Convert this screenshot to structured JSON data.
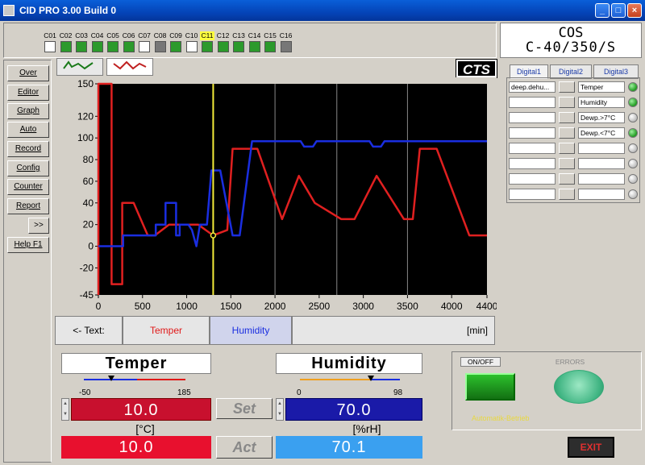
{
  "window": {
    "title": "CID PRO 3.00 Build 0",
    "min": "_",
    "max": "□",
    "close": "×"
  },
  "channels": [
    {
      "label": "C01",
      "state": "white"
    },
    {
      "label": "C02",
      "state": "green"
    },
    {
      "label": "C03",
      "state": "green"
    },
    {
      "label": "C04",
      "state": "green"
    },
    {
      "label": "C05",
      "state": "green"
    },
    {
      "label": "C06",
      "state": "green"
    },
    {
      "label": "C07",
      "state": "white"
    },
    {
      "label": "C08",
      "state": "gray"
    },
    {
      "label": "C09",
      "state": "green"
    },
    {
      "label": "C10",
      "state": "white"
    },
    {
      "label": "C11",
      "state": "green",
      "highlight": true
    },
    {
      "label": "C12",
      "state": "green"
    },
    {
      "label": "C13",
      "state": "green"
    },
    {
      "label": "C14",
      "state": "green"
    },
    {
      "label": "C15",
      "state": "green"
    },
    {
      "label": "C16",
      "state": "gray"
    }
  ],
  "cos": {
    "line1": "COS",
    "line2": "C-40/350/S"
  },
  "nav": [
    "Over",
    "Editor",
    "Graph",
    "Auto",
    "Record",
    "Config",
    "Counter",
    "Report",
    ">>",
    "Help F1"
  ],
  "logo": "CTS",
  "digital_tabs": [
    "Digital1",
    "Digital2",
    "Digital3"
  ],
  "digital_rows": [
    {
      "left": "deep.dehu...",
      "right": "Temper",
      "led": "on"
    },
    {
      "left": "",
      "right": "Humidity",
      "led": "on"
    },
    {
      "left": "",
      "right": "Dewp.>7°C",
      "led": "off"
    },
    {
      "left": "",
      "right": "Dewp.<7°C",
      "led": "on"
    },
    {
      "left": "",
      "right": "",
      "led": "off"
    },
    {
      "left": "",
      "right": "",
      "led": "off"
    },
    {
      "left": "",
      "right": "",
      "led": "off"
    },
    {
      "left": "",
      "right": "",
      "led": "off"
    }
  ],
  "legend": {
    "text_button": "<- Text:",
    "series1": "Temper",
    "series2": "Humidity",
    "unit": "[min]"
  },
  "temper": {
    "title": "Temper",
    "scale_min": "-50",
    "scale_max": "185",
    "set": "10.0",
    "act": "10.0",
    "unit": "[°C]"
  },
  "humidity": {
    "title": "Humidity",
    "scale_min": "0",
    "scale_max": "98",
    "set": "70.0",
    "act": "70.1",
    "unit": "[%rH]"
  },
  "buttons": {
    "set": "Set",
    "act": "Act"
  },
  "onoff": {
    "label": "ON/OFF",
    "errors": "ERRORS",
    "status": "Automatik-Betrieb"
  },
  "exit": {
    "label": "EXIT"
  },
  "chart_data": {
    "type": "line",
    "xlabel": "[min]",
    "ylabel": "",
    "xlim": [
      0,
      4400
    ],
    "ylim": [
      -45,
      150
    ],
    "xticks": [
      0,
      500,
      1000,
      1500,
      2000,
      2500,
      3000,
      3500,
      4000,
      4400
    ],
    "yticks": [
      150,
      120,
      100,
      80,
      60,
      40,
      20,
      0,
      -20,
      -45
    ],
    "cursor_x": 1300,
    "grid": "vertical",
    "series": [
      {
        "name": "Temper",
        "color": "#e02020",
        "points": [
          [
            0,
            -45
          ],
          [
            0,
            150
          ],
          [
            150,
            150
          ],
          [
            150,
            -35
          ],
          [
            270,
            -35
          ],
          [
            270,
            40
          ],
          [
            400,
            40
          ],
          [
            560,
            10
          ],
          [
            640,
            10
          ],
          [
            800,
            20
          ],
          [
            980,
            20
          ],
          [
            1130,
            20
          ],
          [
            1300,
            10
          ],
          [
            1460,
            15
          ],
          [
            1520,
            90
          ],
          [
            1800,
            90
          ],
          [
            2080,
            25
          ],
          [
            2270,
            65
          ],
          [
            2450,
            40
          ],
          [
            2750,
            25
          ],
          [
            2900,
            25
          ],
          [
            3150,
            65
          ],
          [
            3460,
            25
          ],
          [
            3560,
            25
          ],
          [
            3640,
            90
          ],
          [
            3830,
            90
          ],
          [
            4200,
            10
          ],
          [
            4400,
            10
          ]
        ]
      },
      {
        "name": "Humidity",
        "color": "#1a2ee0",
        "points": [
          [
            0,
            0
          ],
          [
            280,
            0
          ],
          [
            280,
            10
          ],
          [
            650,
            10
          ],
          [
            650,
            20
          ],
          [
            760,
            20
          ],
          [
            760,
            40
          ],
          [
            880,
            40
          ],
          [
            880,
            10
          ],
          [
            920,
            10
          ],
          [
            920,
            20
          ],
          [
            1020,
            20
          ],
          [
            1060,
            15
          ],
          [
            1110,
            0
          ],
          [
            1150,
            20
          ],
          [
            1230,
            20
          ],
          [
            1280,
            70
          ],
          [
            1380,
            70
          ],
          [
            1520,
            10
          ],
          [
            1600,
            10
          ],
          [
            1740,
            97
          ],
          [
            2290,
            97
          ],
          [
            2330,
            92
          ],
          [
            2430,
            92
          ],
          [
            2470,
            97
          ],
          [
            3070,
            97
          ],
          [
            3110,
            92
          ],
          [
            3200,
            92
          ],
          [
            3240,
            97
          ],
          [
            4400,
            97
          ]
        ]
      }
    ]
  }
}
